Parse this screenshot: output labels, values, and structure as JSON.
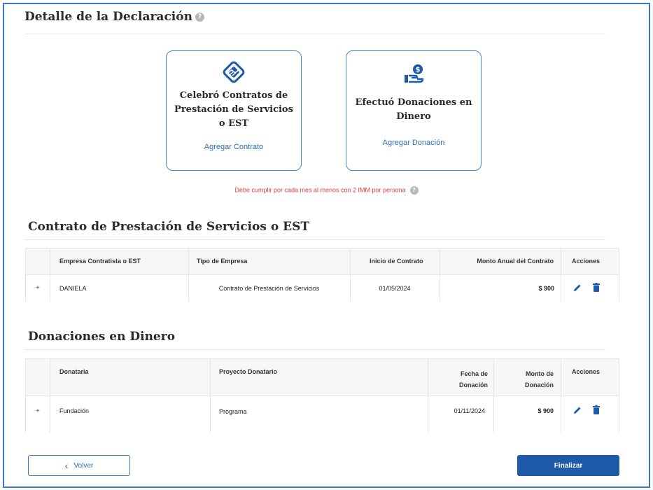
{
  "header": {
    "title": "Detalle de la Declaración",
    "help_glyph": "?"
  },
  "cards": {
    "contratos": {
      "title": "Celebró Contratos de Prestación de Servicios o EST",
      "link": "Agregar Contrato",
      "icon": "handshake-diamond-icon"
    },
    "donaciones": {
      "title": "Efectuó Donaciones en Dinero",
      "link": "Agregar Donación",
      "icon": "hand-coin-icon"
    }
  },
  "warning": "Debe cumplir por cada mes al menos con 2 IMM por persona",
  "contratos_section": {
    "title": "Contrato de Prestación de Servicios o EST",
    "headers": {
      "empresa": "Empresa Contratista o EST",
      "tipo": "Tipo de Empresa",
      "inicio": "Inicio de Contrato",
      "monto": "Monto Anual del Contrato",
      "acciones": "Acciones"
    },
    "rows": [
      {
        "expander": "+",
        "empresa": "DANIELA",
        "tipo": "Contrato de Prestación de Servicios",
        "inicio": "01/05/2024",
        "monto": "$ 900"
      }
    ]
  },
  "donaciones_section": {
    "title": "Donaciones en Dinero",
    "headers": {
      "donataria": "Donataria",
      "proyecto": "Proyecto Donatario",
      "fecha_l1": "Fecha de",
      "fecha_l2": "Donación",
      "monto_l1": "Monto de",
      "monto_l2": "Donación",
      "acciones": "Acciones"
    },
    "rows": [
      {
        "expander": "+",
        "donataria": "Fundación",
        "proyecto": "Programa",
        "fecha": "01/11/2024",
        "monto": "$ 900"
      }
    ]
  },
  "footer": {
    "back_label": "Volver",
    "back_glyph": "‹",
    "finish_label": "Finalizar"
  },
  "colors": {
    "accent": "#1e5aa8",
    "link": "#2d6fb8",
    "warning": "#e53b3b",
    "border": "#4a86c9"
  }
}
